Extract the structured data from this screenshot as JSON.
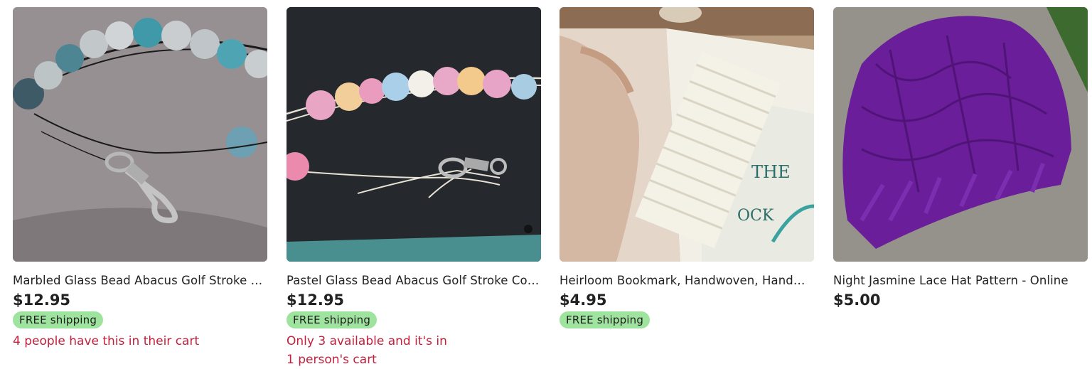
{
  "listings": [
    {
      "title": "Marbled Glass Bead Abacus Golf Stroke Counter",
      "price": "$12.95",
      "shipping_badge": "FREE shipping",
      "cart_note": "4 people have this in their cart"
    },
    {
      "title": "Pastel Glass Bead Abacus Golf Stroke Counter",
      "price": "$12.95",
      "shipping_badge": "FREE shipping",
      "cart_note_line1": "Only 3 available and it's in",
      "cart_note_line2": "1 person's cart"
    },
    {
      "title": "Heirloom Bookmark, Handwoven, Handmade",
      "price": "$4.95",
      "shipping_badge": "FREE shipping"
    },
    {
      "title": "Night Jasmine Lace Hat Pattern - Online",
      "price": "$5.00"
    }
  ],
  "colors": {
    "badge_bg": "#9ee39e",
    "cart_note": "#c2203c",
    "text": "#222222"
  }
}
